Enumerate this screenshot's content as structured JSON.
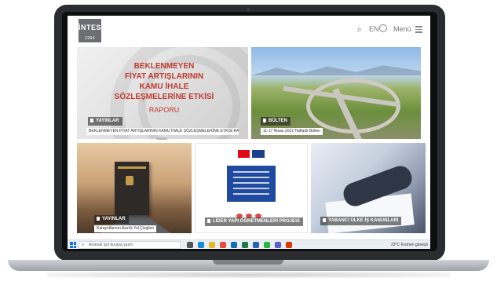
{
  "header": {
    "logo_text": "İNTES",
    "logo_year": "1964",
    "lang_label": "EN",
    "menu_label": "Menü"
  },
  "cards": {
    "report": {
      "headline_lines": [
        "BEKLENMEYEN",
        "FİYAT ARTIŞLARININ",
        "KAMU İHALE",
        "SÖZLEŞMELERİNE ETKİSİ"
      ],
      "headline_sub": "RAPORU",
      "tag": "YAYINLAR",
      "caption": "BEKLENMEYEN FİYAT ARTIŞLARININ KAMU İHALE SÖZLEŞMELERİNE ETKİSİ RAPORU"
    },
    "bulletin": {
      "tag": "BÜLTEN",
      "caption": "11-17 Nisan 2022 Haftalık Bülten"
    },
    "roads": {
      "tag": "YAYINLAR",
      "caption": "Karayollarının Asırlık Yol Çizgileri"
    },
    "teachers": {
      "tag": "LİDER YAPI ÖĞRETMENLERİ PROJESİ"
    },
    "foreign": {
      "tag": "YABANCI ÜLKE İŞ KANUNLARI"
    }
  },
  "taskbar": {
    "search_placeholder": "Aramak için buraya yazın",
    "weather": "23°C  Kısmen güneşli",
    "apps": [
      "task-view",
      "edge",
      "file-explorer",
      "chrome",
      "outlook",
      "excel",
      "word",
      "whatsapp",
      "teams",
      "office"
    ],
    "app_colors": [
      "#555555",
      "#1b8ad6",
      "#e8b325",
      "#e44b3b",
      "#0f6cbd",
      "#1f7a44",
      "#2b5fb8",
      "#2cb742",
      "#5b5fc7",
      "#d83b01"
    ]
  },
  "colors": {
    "accent_red": "#c0392b",
    "logo_gray": "#6d6e71"
  }
}
